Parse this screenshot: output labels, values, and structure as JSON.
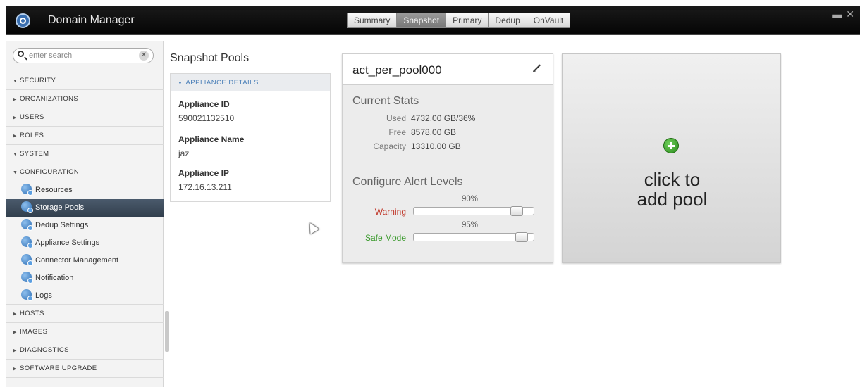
{
  "app": {
    "title": "Domain Manager"
  },
  "tabs": [
    {
      "label": "Summary",
      "active": false
    },
    {
      "label": "Snapshot",
      "active": true
    },
    {
      "label": "Primary",
      "active": false
    },
    {
      "label": "Dedup",
      "active": false
    },
    {
      "label": "OnVault",
      "active": false
    }
  ],
  "window_controls": {
    "minimize": "▬",
    "close": "✕"
  },
  "search": {
    "placeholder": "enter search",
    "clear": "✕"
  },
  "sidebar": {
    "items": [
      {
        "label": "SECURITY",
        "level": "section",
        "expanded": true
      },
      {
        "label": "ORGANIZATIONS",
        "level": "sub",
        "expanded": false
      },
      {
        "label": "USERS",
        "level": "sub",
        "expanded": false
      },
      {
        "label": "ROLES",
        "level": "sub",
        "expanded": false
      },
      {
        "label": "SYSTEM",
        "level": "section",
        "expanded": true
      },
      {
        "label": "CONFIGURATION",
        "level": "sub",
        "expanded": true
      },
      {
        "label": "Resources",
        "level": "leaf"
      },
      {
        "label": "Storage Pools",
        "level": "leaf",
        "selected": true
      },
      {
        "label": "Dedup Settings",
        "level": "leaf"
      },
      {
        "label": "Appliance Settings",
        "level": "leaf"
      },
      {
        "label": "Connector Management",
        "level": "leaf"
      },
      {
        "label": "Notification",
        "level": "leaf"
      },
      {
        "label": "Logs",
        "level": "leaf"
      },
      {
        "label": "HOSTS",
        "level": "sub",
        "expanded": false
      },
      {
        "label": "IMAGES",
        "level": "sub",
        "expanded": false
      },
      {
        "label": "DIAGNOSTICS",
        "level": "sub",
        "expanded": false
      },
      {
        "label": "SOFTWARE UPGRADE",
        "level": "sub",
        "expanded": false
      }
    ]
  },
  "main": {
    "title": "Snapshot Pools",
    "details": {
      "heading": "APPLIANCE DETAILS",
      "appliance_id_label": "Appliance ID",
      "appliance_id": "590021132510",
      "appliance_name_label": "Appliance Name",
      "appliance_name": "jaz",
      "appliance_ip_label": "Appliance IP",
      "appliance_ip": "172.16.13.211"
    },
    "pool": {
      "name": "act_per_pool000",
      "stats_title": "Current Stats",
      "used_label": "Used",
      "used_value": "4732.00 GB/36%",
      "free_label": "Free",
      "free_value": "8578.00 GB",
      "capacity_label": "Capacity",
      "capacity_value": "13310.00 GB",
      "alerts_title": "Configure Alert Levels",
      "warning_label": "Warning",
      "warning_pct": "90%",
      "warning_level": 0.9,
      "safe_label": "Safe Mode",
      "safe_pct": "95%",
      "safe_level": 0.95
    },
    "add_pool": {
      "line1": "click to",
      "line2": "add pool"
    }
  },
  "colors": {
    "accent": "#4a7fb8",
    "warning": "#c0392b",
    "safe_mode": "#3a9a2c",
    "selected_item": "#3c4a59"
  }
}
